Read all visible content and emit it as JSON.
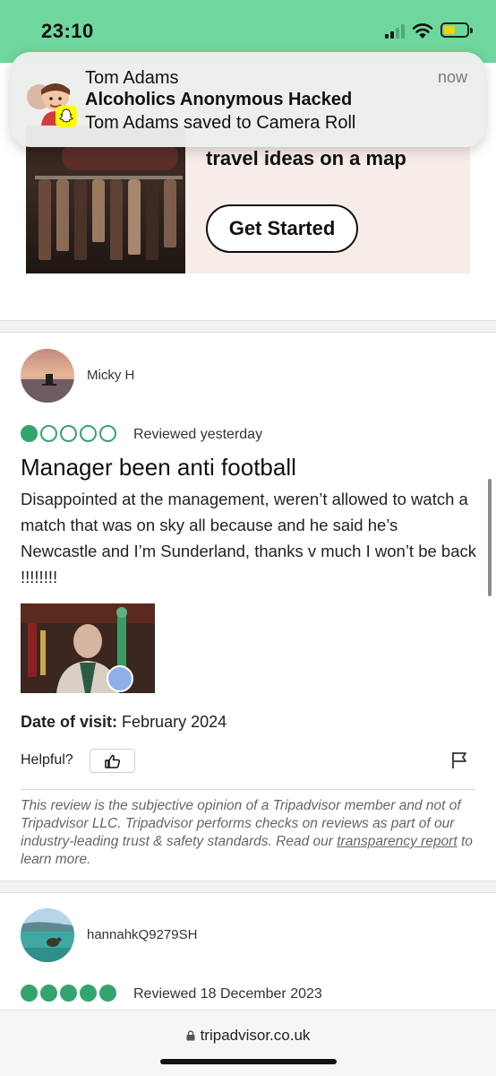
{
  "status_bar": {
    "time": "23:10",
    "color": "#6fd79d",
    "battery_color": "#f2d200",
    "icons": [
      "signal-icon",
      "wifi-icon",
      "battery-icon"
    ]
  },
  "notification": {
    "app_icon": "snapchat-icon",
    "title": "Tom Adams",
    "subtitle": "Alcoholics Anonymous Hacked",
    "body": "Tom Adams saved to Camera Roll",
    "time": "now"
  },
  "ad": {
    "text": "travel ideas on a map",
    "button_label": "Get Started"
  },
  "review1": {
    "username": "Micky H",
    "rating": 1,
    "max_rating": 5,
    "review_date": "Reviewed yesterday",
    "title": "Manager been anti football",
    "body": "Disappointed at the management, weren’t allowed to watch a match that was on sky all because and he said he’s Newcastle and I’m Sunderland, thanks v much I won’t be back !!!!!!!!",
    "visit_label": "Date of visit:",
    "visit_value": "February 2024",
    "helpful_label": "Helpful?"
  },
  "disclaimer": {
    "text": "This review is the subjective opinion of a Tripadvisor member and not of Tripadvisor LLC. Tripadvisor performs checks on reviews as part of our industry-leading trust & safety standards. Read our",
    "link_text": "transparency report",
    "suffix": "to learn more."
  },
  "review2": {
    "username": "hannahkQ9279SH",
    "rating": 5,
    "max_rating": 5,
    "review_date": "Reviewed 18 December 2023"
  },
  "browser": {
    "url": "tripadvisor.co.uk"
  },
  "colors": {
    "bubble_green": "#34a46f"
  }
}
